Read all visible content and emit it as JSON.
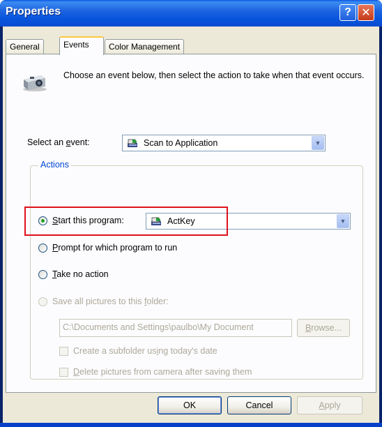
{
  "window": {
    "title": "Properties",
    "help_label": "?",
    "close_label": "✕"
  },
  "tabs": [
    {
      "label": "General"
    },
    {
      "label": "Events"
    },
    {
      "label": "Color Management"
    }
  ],
  "description": "Choose an event below, then select the action to take when that event occurs.",
  "select_event": {
    "label_prefix": "Select an ",
    "label_mnemonic": "e",
    "label_suffix": "vent:",
    "value": "Scan to Application"
  },
  "actions": {
    "group_label": "Actions",
    "start_program": {
      "mnemonic": "S",
      "label_rest": "tart this program:",
      "checked": true,
      "program_value": "ActKey"
    },
    "prompt": {
      "mnemonic": "P",
      "label_rest": "rompt for which program to run"
    },
    "no_action": {
      "mnemonic": "T",
      "label_rest": "ake no action"
    },
    "save_folder": {
      "label_prefix": "Save all pictures to this ",
      "mnemonic": "f",
      "label_rest": "older:",
      "path": "C:\\Documents and Settings\\paulbo\\My Document",
      "browse_mnemonic": "B",
      "browse_rest": "rowse..."
    },
    "subfolder": {
      "label_prefix": "Create a subfolder us",
      "mnemonic": "i",
      "label_rest": "ng today's date"
    },
    "delete_pics": {
      "mnemonic": "D",
      "label_rest": "elete pictures from camera after saving them"
    }
  },
  "buttons": {
    "ok": "OK",
    "cancel": "Cancel",
    "apply_mnemonic": "A",
    "apply_rest": "pply"
  },
  "colors": {
    "highlight": "#e0101a",
    "group_label": "#0046d5",
    "titlebar": "#0855dd"
  }
}
